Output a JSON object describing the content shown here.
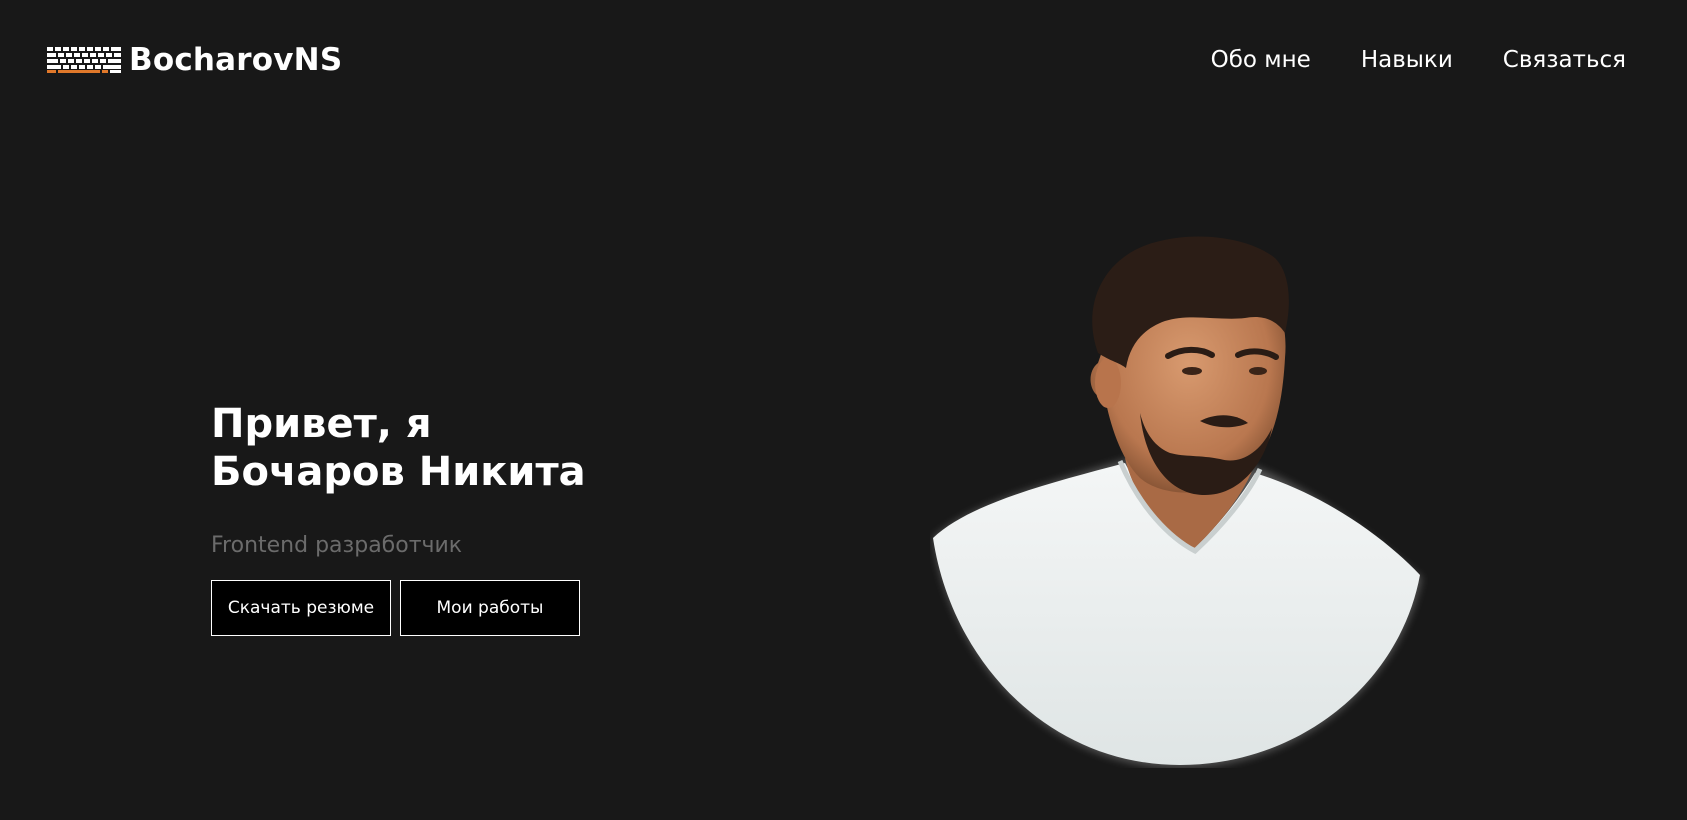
{
  "header": {
    "logo_text": "BocharovNS",
    "logo_icon": "keyboard-icon",
    "nav": [
      {
        "label": "Обо мне"
      },
      {
        "label": "Навыки"
      },
      {
        "label": "Связаться"
      }
    ]
  },
  "hero": {
    "title_line1": "Привет, я",
    "title_line2": "Бочаров Никита",
    "subtitle": "Frontend разработчик",
    "buttons": {
      "resume": "Скачать резюме",
      "works": "Мои работы"
    }
  },
  "colors": {
    "background": "#181818",
    "text": "#ffffff",
    "subtitle": "#6b6b6b",
    "accent": "#e0782a"
  }
}
